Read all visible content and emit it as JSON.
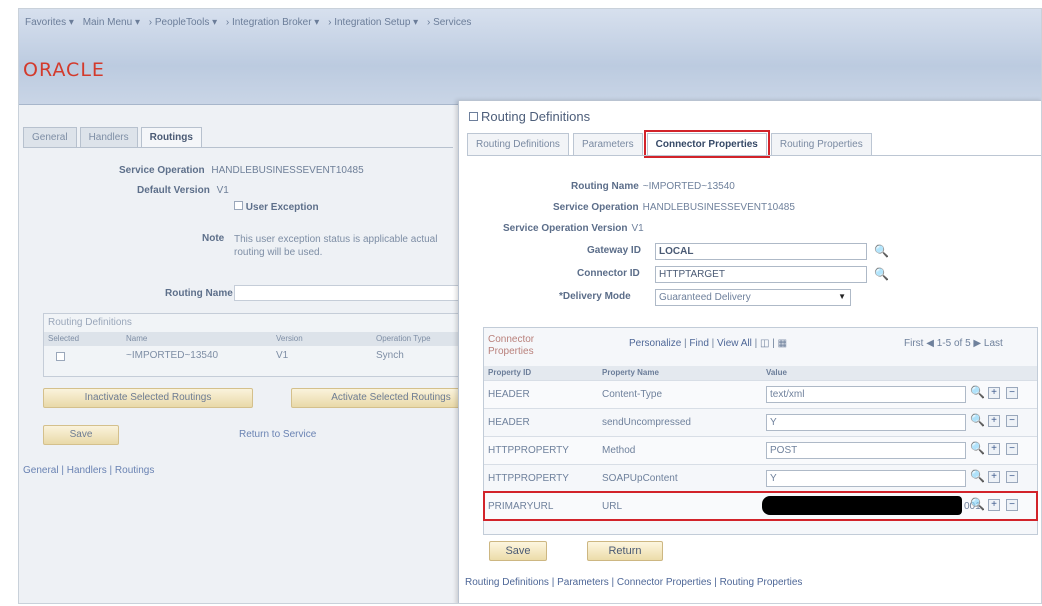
{
  "topnav": [
    "Favorites ▾",
    "Main Menu ▾",
    "› PeopleTools ▾",
    "› Integration Broker ▾",
    "› Integration Setup ▾",
    "› Services"
  ],
  "logo": "ORACLE",
  "background": {
    "tabs": [
      "General",
      "Handlers",
      "Routings"
    ],
    "service_operation_label": "Service Operation",
    "service_operation_value": "HANDLEBUSINESSEVENT10485",
    "default_version_label": "Default Version",
    "default_version_value": "V1",
    "user_exception_label": "User Exception",
    "note_label": "Note",
    "note_text": "This user exception status is applicable actual routing will be used.",
    "routing_name_label": "Routing Name",
    "routing_definitions_title": "Routing Definitions",
    "grid_headers": [
      "Selected",
      "Name",
      "Version",
      "Operation Type"
    ],
    "grid_row": {
      "name": "~IMPORTED~13540",
      "version": "V1",
      "type": "Synch"
    },
    "inactivate_button": "Inactivate Selected Routings",
    "activate_button": "Activate Selected Routings",
    "save_button": "Save",
    "return_link": "Return to Service",
    "footer_links": "General | Handlers | Routings"
  },
  "modal": {
    "title": "Routing Definitions",
    "tabs": [
      "Routing Definitions",
      "Parameters",
      "Connector Properties",
      "Routing Properties"
    ],
    "routing_name_label": "Routing Name",
    "routing_name_value": "~IMPORTED~13540",
    "service_operation_label": "Service Operation",
    "service_operation_value": "HANDLEBUSINESSEVENT10485",
    "service_operation_version_label": "Service Operation Version",
    "service_operation_version_value": "V1",
    "gateway_id_label": "Gateway ID",
    "gateway_id_value": "LOCAL",
    "connector_id_label": "Connector ID",
    "connector_id_value": "HTTPTARGET",
    "delivery_mode_label": "*Delivery Mode",
    "delivery_mode_value": "Guaranteed Delivery",
    "grid_title": "Connector Properties",
    "grid_tools": {
      "personalize": "Personalize",
      "find": "Find",
      "view_all": "View All"
    },
    "grid_nav": {
      "first": "First",
      "range": "1-5 of 5",
      "last": "Last"
    },
    "grid_headers": [
      "Property ID",
      "Property Name",
      "Value"
    ],
    "rows": [
      {
        "id": "HEADER",
        "name": "Content-Type",
        "value": "text/xml"
      },
      {
        "id": "HEADER",
        "name": "sendUncompressed",
        "value": "Y"
      },
      {
        "id": "HTTPPROPERTY",
        "name": "Method",
        "value": "POST"
      },
      {
        "id": "HTTPPROPERTY",
        "name": "SOAPUpContent",
        "value": "Y"
      },
      {
        "id": "PRIMARYURL",
        "name": "URL",
        "value_tail": "001"
      }
    ],
    "save_button": "Save",
    "return_button": "Return",
    "footer_links": "Routing Definitions | Parameters | Connector Properties | Routing Properties"
  },
  "colors": {
    "highlight": "#d2232a",
    "oracle_red": "#d33a2c"
  }
}
